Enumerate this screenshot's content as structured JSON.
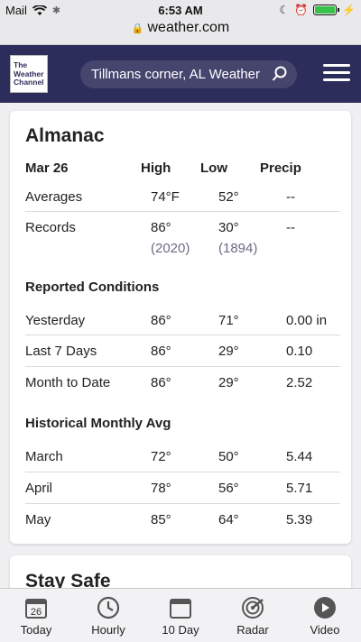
{
  "status_bar": {
    "carrier": "Mail",
    "time": "6:53 AM",
    "url": "weather.com"
  },
  "header": {
    "logo_text": "The Weather Channel",
    "search_text": "Tillmans corner, AL Weather"
  },
  "almanac": {
    "title": "Almanac",
    "columns": [
      "Mar 26",
      "High",
      "Low",
      "Precip"
    ],
    "averages": {
      "label": "Averages",
      "high": "74°F",
      "low": "52°",
      "precip": "--"
    },
    "records": {
      "label": "Records",
      "high": "86°",
      "high_year": "(2020)",
      "low": "30°",
      "low_year": "(1894)",
      "precip": "--"
    },
    "reported": {
      "title": "Reported Conditions",
      "rows": [
        {
          "label": "Yesterday",
          "high": "86°",
          "low": "71°",
          "precip": "0.00 in"
        },
        {
          "label": "Last 7 Days",
          "high": "86°",
          "low": "29°",
          "precip": "0.10"
        },
        {
          "label": "Month to Date",
          "high": "86°",
          "low": "29°",
          "precip": "2.52"
        }
      ]
    },
    "historical": {
      "title": "Historical Monthly Avg",
      "rows": [
        {
          "label": "March",
          "high": "72°",
          "low": "50°",
          "precip": "5.44"
        },
        {
          "label": "April",
          "high": "78°",
          "low": "56°",
          "precip": "5.71"
        },
        {
          "label": "May",
          "high": "85°",
          "low": "64°",
          "precip": "5.39"
        }
      ]
    }
  },
  "next_card": {
    "title": "Stay Safe"
  },
  "bottom_nav": {
    "today_date": "26",
    "items": [
      "Today",
      "Hourly",
      "10 Day",
      "Radar",
      "Video"
    ]
  },
  "colors": {
    "header_bg": "#2d2d5c",
    "accent_text": "#6b6b85",
    "battery": "#37c34a"
  }
}
